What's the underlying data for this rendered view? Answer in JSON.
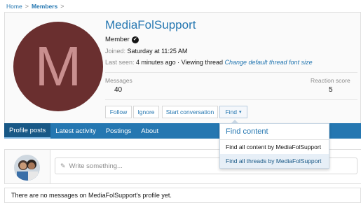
{
  "breadcrumb": {
    "home": "Home",
    "members": "Members",
    "sep": ">"
  },
  "profile": {
    "avatar_letter": "M",
    "avatar_color": "#6a2f2f",
    "username": "MediaFolSupport",
    "title": "Member",
    "verified_icon": "✔",
    "joined_label": "Joined:",
    "joined_value": "Saturday at 11:25 AM",
    "last_seen_label": "Last seen:",
    "last_seen_value": "4 minutes ago · Viewing thread",
    "last_seen_link": "Change default thread font size"
  },
  "stats": {
    "messages_label": "Messages",
    "messages_value": "40",
    "reaction_label": "Reaction score",
    "reaction_value": "5"
  },
  "actions": {
    "follow": "Follow",
    "ignore": "Ignore",
    "start_conversation": "Start conversation",
    "find": "Find",
    "caret": "▾"
  },
  "tabs": [
    "Profile posts",
    "Latest activity",
    "Postings",
    "About"
  ],
  "find_menu": {
    "title": "Find content",
    "items": [
      "Find all content by MediaFolSupport",
      "Find all threads by MediaFolSupport"
    ]
  },
  "composer": {
    "placeholder": "Write something...",
    "icon": "pencil-icon"
  },
  "notice": "There are no messages on MediaFolSupport's profile yet.",
  "colors": {
    "accent": "#2577b1",
    "tab_active": "#185886"
  }
}
